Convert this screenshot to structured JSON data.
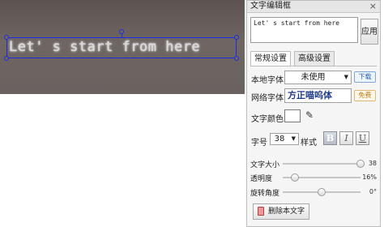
{
  "canvas": {
    "text_layer": "Let' s start from here"
  },
  "panel": {
    "title": "文字编辑框",
    "close": "×",
    "editor_text": "Let' s start from here",
    "apply_label": "应用",
    "tabs": [
      {
        "label": "常规设置",
        "active": true
      },
      {
        "label": "高级设置",
        "active": false
      }
    ],
    "local_font": {
      "label": "本地字体",
      "value": "未使用",
      "button": "下载"
    },
    "web_font": {
      "label": "网络字体",
      "preview": "方正喵呜体",
      "button": "免费"
    },
    "text_color": {
      "label": "文字颜色"
    },
    "size": {
      "label": "字号",
      "value": "38"
    },
    "style": {
      "label": "样式",
      "bold": "B",
      "italic": "I",
      "underline": "U"
    },
    "sliders": [
      {
        "label": "文字大小",
        "value": "38",
        "level": 1.0
      },
      {
        "label": "透明度",
        "value": "16%",
        "level": 0.16
      },
      {
        "label": "旋转角度",
        "value": "0°",
        "level": 0.5
      }
    ],
    "delete_label": "删除本文字"
  }
}
